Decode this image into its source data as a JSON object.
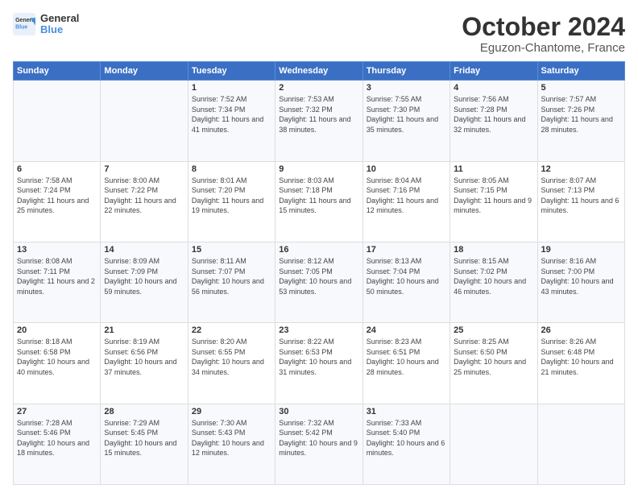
{
  "header": {
    "logo_general": "General",
    "logo_blue": "Blue",
    "title": "October 2024",
    "subtitle": "Eguzon-Chantome, France"
  },
  "days_of_week": [
    "Sunday",
    "Monday",
    "Tuesday",
    "Wednesday",
    "Thursday",
    "Friday",
    "Saturday"
  ],
  "weeks": [
    [
      {
        "day": "",
        "info": ""
      },
      {
        "day": "",
        "info": ""
      },
      {
        "day": "1",
        "info": "Sunrise: 7:52 AM\nSunset: 7:34 PM\nDaylight: 11 hours and 41 minutes."
      },
      {
        "day": "2",
        "info": "Sunrise: 7:53 AM\nSunset: 7:32 PM\nDaylight: 11 hours and 38 minutes."
      },
      {
        "day": "3",
        "info": "Sunrise: 7:55 AM\nSunset: 7:30 PM\nDaylight: 11 hours and 35 minutes."
      },
      {
        "day": "4",
        "info": "Sunrise: 7:56 AM\nSunset: 7:28 PM\nDaylight: 11 hours and 32 minutes."
      },
      {
        "day": "5",
        "info": "Sunrise: 7:57 AM\nSunset: 7:26 PM\nDaylight: 11 hours and 28 minutes."
      }
    ],
    [
      {
        "day": "6",
        "info": "Sunrise: 7:58 AM\nSunset: 7:24 PM\nDaylight: 11 hours and 25 minutes."
      },
      {
        "day": "7",
        "info": "Sunrise: 8:00 AM\nSunset: 7:22 PM\nDaylight: 11 hours and 22 minutes."
      },
      {
        "day": "8",
        "info": "Sunrise: 8:01 AM\nSunset: 7:20 PM\nDaylight: 11 hours and 19 minutes."
      },
      {
        "day": "9",
        "info": "Sunrise: 8:03 AM\nSunset: 7:18 PM\nDaylight: 11 hours and 15 minutes."
      },
      {
        "day": "10",
        "info": "Sunrise: 8:04 AM\nSunset: 7:16 PM\nDaylight: 11 hours and 12 minutes."
      },
      {
        "day": "11",
        "info": "Sunrise: 8:05 AM\nSunset: 7:15 PM\nDaylight: 11 hours and 9 minutes."
      },
      {
        "day": "12",
        "info": "Sunrise: 8:07 AM\nSunset: 7:13 PM\nDaylight: 11 hours and 6 minutes."
      }
    ],
    [
      {
        "day": "13",
        "info": "Sunrise: 8:08 AM\nSunset: 7:11 PM\nDaylight: 11 hours and 2 minutes."
      },
      {
        "day": "14",
        "info": "Sunrise: 8:09 AM\nSunset: 7:09 PM\nDaylight: 10 hours and 59 minutes."
      },
      {
        "day": "15",
        "info": "Sunrise: 8:11 AM\nSunset: 7:07 PM\nDaylight: 10 hours and 56 minutes."
      },
      {
        "day": "16",
        "info": "Sunrise: 8:12 AM\nSunset: 7:05 PM\nDaylight: 10 hours and 53 minutes."
      },
      {
        "day": "17",
        "info": "Sunrise: 8:13 AM\nSunset: 7:04 PM\nDaylight: 10 hours and 50 minutes."
      },
      {
        "day": "18",
        "info": "Sunrise: 8:15 AM\nSunset: 7:02 PM\nDaylight: 10 hours and 46 minutes."
      },
      {
        "day": "19",
        "info": "Sunrise: 8:16 AM\nSunset: 7:00 PM\nDaylight: 10 hours and 43 minutes."
      }
    ],
    [
      {
        "day": "20",
        "info": "Sunrise: 8:18 AM\nSunset: 6:58 PM\nDaylight: 10 hours and 40 minutes."
      },
      {
        "day": "21",
        "info": "Sunrise: 8:19 AM\nSunset: 6:56 PM\nDaylight: 10 hours and 37 minutes."
      },
      {
        "day": "22",
        "info": "Sunrise: 8:20 AM\nSunset: 6:55 PM\nDaylight: 10 hours and 34 minutes."
      },
      {
        "day": "23",
        "info": "Sunrise: 8:22 AM\nSunset: 6:53 PM\nDaylight: 10 hours and 31 minutes."
      },
      {
        "day": "24",
        "info": "Sunrise: 8:23 AM\nSunset: 6:51 PM\nDaylight: 10 hours and 28 minutes."
      },
      {
        "day": "25",
        "info": "Sunrise: 8:25 AM\nSunset: 6:50 PM\nDaylight: 10 hours and 25 minutes."
      },
      {
        "day": "26",
        "info": "Sunrise: 8:26 AM\nSunset: 6:48 PM\nDaylight: 10 hours and 21 minutes."
      }
    ],
    [
      {
        "day": "27",
        "info": "Sunrise: 7:28 AM\nSunset: 5:46 PM\nDaylight: 10 hours and 18 minutes."
      },
      {
        "day": "28",
        "info": "Sunrise: 7:29 AM\nSunset: 5:45 PM\nDaylight: 10 hours and 15 minutes."
      },
      {
        "day": "29",
        "info": "Sunrise: 7:30 AM\nSunset: 5:43 PM\nDaylight: 10 hours and 12 minutes."
      },
      {
        "day": "30",
        "info": "Sunrise: 7:32 AM\nSunset: 5:42 PM\nDaylight: 10 hours and 9 minutes."
      },
      {
        "day": "31",
        "info": "Sunrise: 7:33 AM\nSunset: 5:40 PM\nDaylight: 10 hours and 6 minutes."
      },
      {
        "day": "",
        "info": ""
      },
      {
        "day": "",
        "info": ""
      }
    ]
  ]
}
